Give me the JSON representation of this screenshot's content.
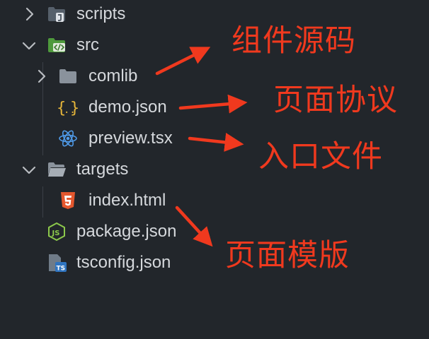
{
  "explorer": {
    "items": [
      {
        "label": "scripts"
      },
      {
        "label": "src"
      },
      {
        "label": "comlib"
      },
      {
        "label": "demo.json"
      },
      {
        "label": "preview.tsx"
      },
      {
        "label": "targets"
      },
      {
        "label": "index.html"
      },
      {
        "label": "package.json"
      },
      {
        "label": "tsconfig.json"
      }
    ]
  },
  "annotations": {
    "component_source": "组件源码",
    "page_protocol": "页面协议",
    "entry_file": "入口文件",
    "page_template": "页面模版"
  },
  "icons": {
    "scripts": "folder-script-icon",
    "src": "folder-src-icon",
    "comlib": "folder-icon",
    "demo_json": "json-braces-icon",
    "preview_tsx": "react-icon",
    "targets": "folder-open-icon",
    "index_html": "html5-icon",
    "package_json": "nodejs-icon",
    "tsconfig_json": "typescript-config-icon"
  },
  "colors": {
    "background": "#22262b",
    "text": "#d5d8dc",
    "annotation": "#f0391e",
    "chevron": "#b9bcc1"
  }
}
